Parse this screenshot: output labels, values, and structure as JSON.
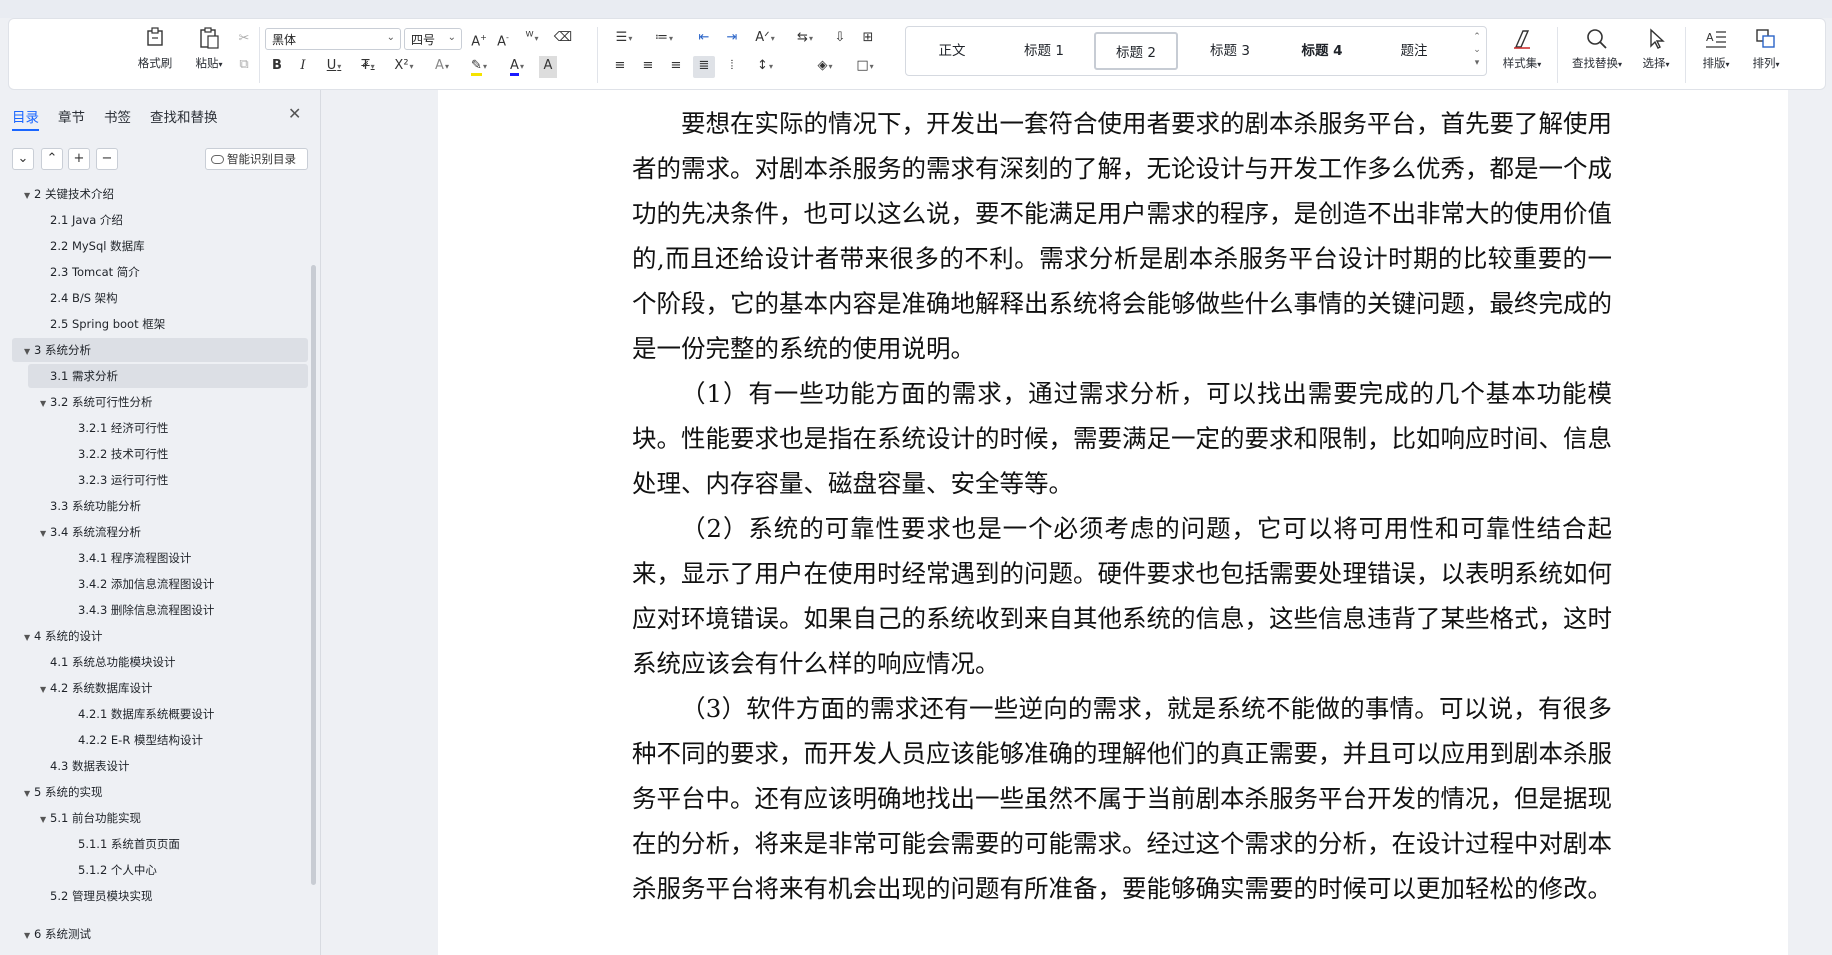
{
  "ribbon": {
    "format_painter": "格式刷",
    "paste": "粘贴",
    "font_name": "黑体",
    "font_size": "四号",
    "styles": [
      "正文",
      "标题 1",
      "标题 2",
      "标题 3",
      "标题 4",
      "题注"
    ],
    "style_set": "样式集",
    "find_replace": "查找替换",
    "select": "选择",
    "layout": "排版",
    "arrange": "排列"
  },
  "nav": {
    "tabs": [
      "目录",
      "章节",
      "书签",
      "查找和替换"
    ],
    "smart_toc": "智能识别目录",
    "items": [
      {
        "label": "2   关键技术介绍",
        "level": 0,
        "expand": true
      },
      {
        "label": "2.1 Java 介绍",
        "level": 1
      },
      {
        "label": "2.2 MySql 数据库",
        "level": 1
      },
      {
        "label": "2.3 Tomcat 简介",
        "level": 1
      },
      {
        "label": "2.4 B/S 架构",
        "level": 1
      },
      {
        "label": "2.5 Spring boot 框架",
        "level": 1
      },
      {
        "label": "3   系统分析",
        "level": 0,
        "expand": true,
        "highlight": true
      },
      {
        "label": "3.1 需求分析",
        "level": 1,
        "highlight": true
      },
      {
        "label": "3.2  系统可行性分析",
        "level": 1,
        "expand": true
      },
      {
        "label": "3.2.1 经济可行性",
        "level": 2
      },
      {
        "label": "3.2.2 技术可行性",
        "level": 2
      },
      {
        "label": "3.2.3 运行可行性",
        "level": 2
      },
      {
        "label": "3.3  系统功能分析",
        "level": 1
      },
      {
        "label": "3.4 系统流程分析",
        "level": 1,
        "expand": true
      },
      {
        "label": "3.4.1 程序流程图设计",
        "level": 2
      },
      {
        "label": "3.4.2 添加信息流程图设计",
        "level": 2
      },
      {
        "label": "3.4.3 删除信息流程图设计",
        "level": 2
      },
      {
        "label": "4   系统的设计",
        "level": 0,
        "expand": true
      },
      {
        "label": "4.1  系统总功能模块设计",
        "level": 1
      },
      {
        "label": "4.2  系统数据库设计",
        "level": 1,
        "expand": true
      },
      {
        "label": "4.2.1  数据库系统概要设计",
        "level": 2
      },
      {
        "label": "4.2.2 E-R 模型结构设计",
        "level": 2
      },
      {
        "label": "4.3 数据表设计",
        "level": 1
      },
      {
        "label": "5   系统的实现",
        "level": 0,
        "expand": true
      },
      {
        "label": "5.1 前台功能实现",
        "level": 1,
        "expand": true
      },
      {
        "label": "5.1.1 系统首页页面",
        "level": 2
      },
      {
        "label": "5.1.2 个人中心",
        "level": 2
      },
      {
        "label": "5.2 管理员模块实现",
        "level": 1
      },
      {
        "label": "6 系统测试",
        "level": 0,
        "expand": true,
        "gap": true
      }
    ]
  },
  "document": {
    "paragraphs": [
      "要想在实际的情况下，开发出一套符合使用者要求的剧本杀服务平台，首先要了解使用者的需求。对剧本杀服务的需求有深刻的了解，无论设计与开发工作多么优秀，都是一个成功的先决条件，也可以这么说，要不能满足用户需求的程序，是创造不出非常大的使用价值的,而且还给设计者带来很多的不利。需求分析是剧本杀服务平台设计时期的比较重要的一个阶段，它的基本内容是准确地解释出系统将会能够做些什么事情的关键问题，最终完成的是一份完整的系统的使用说明。",
      "（1）有一些功能方面的需求，通过需求分析，可以找出需要完成的几个基本功能模块。性能要求也是指在系统设计的时候，需要满足一定的要求和限制，比如响应时间、信息处理、内存容量、磁盘容量、安全等等。",
      "（2）系统的可靠性要求也是一个必须考虑的问题，它可以将可用性和可靠性结合起来，显示了用户在使用时经常遇到的问题。硬件要求也包括需要处理错误，以表明系统如何应对环境错误。如果自己的系统收到来自其他系统的信息，这些信息违背了某些格式，这时系统应该会有什么样的响应情况。",
      "（3）软件方面的需求还有一些逆向的需求，就是系统不能做的事情。可以说，有很多种不同的要求，而开发人员应该能够准确的理解他们的真正需要，并且可以应用到剧本杀服务平台中。还有应该明确地找出一些虽然不属于当前剧本杀服务平台开发的情况，但是据现在的分析，将来是非常可能会需要的可能需求。经过这个需求的分析，在设计过程中对剧本杀服务平台将来有机会出现的问题有所准备，要能够确实需要的时候可以更加轻松的修改。"
    ]
  }
}
